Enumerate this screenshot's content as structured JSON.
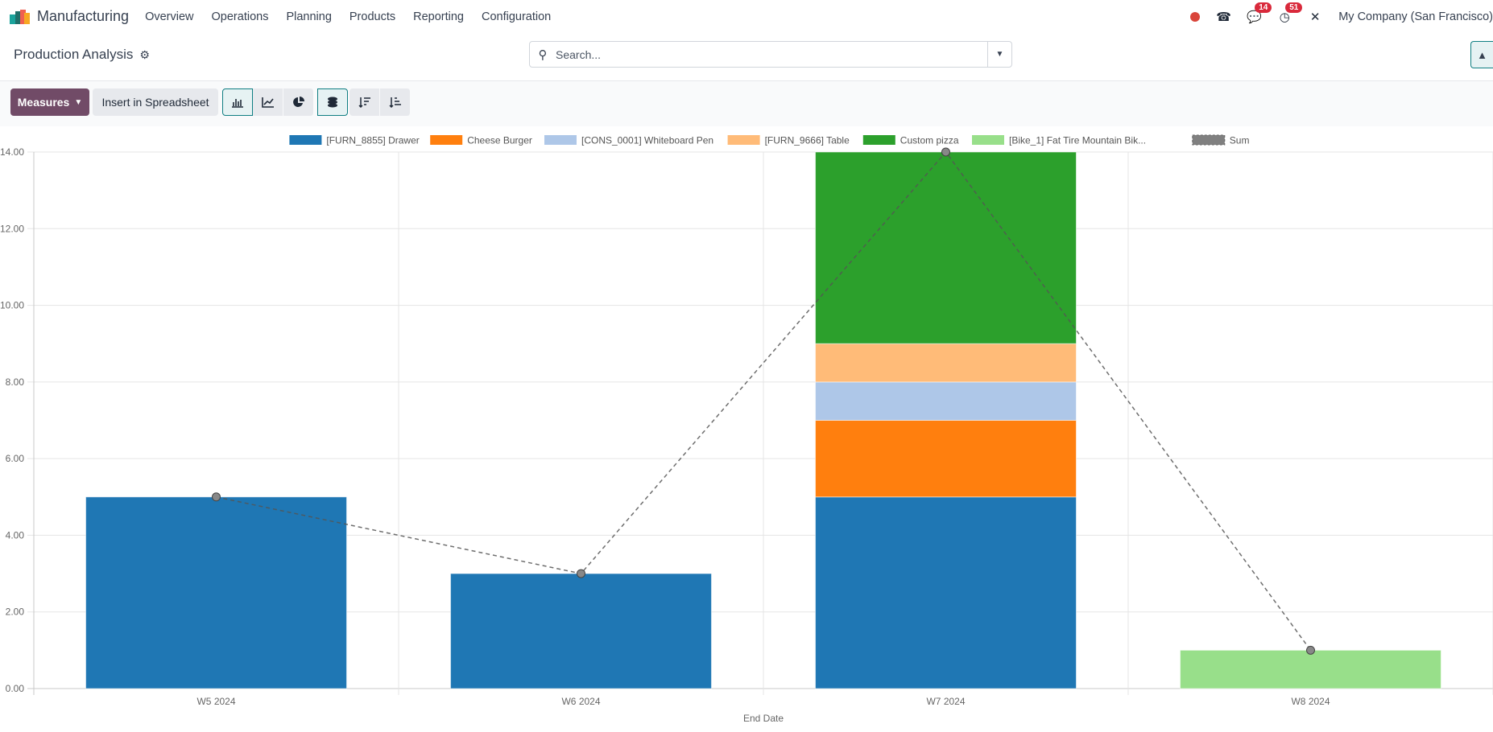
{
  "navbar": {
    "app_name": "Manufacturing",
    "menu": [
      "Overview",
      "Operations",
      "Planning",
      "Products",
      "Reporting",
      "Configuration"
    ],
    "messages_count": "14",
    "activities_count": "51",
    "company": "My Company (San Francisco)"
  },
  "control_panel": {
    "title": "Production Analysis",
    "search_placeholder": "Search..."
  },
  "toolbar": {
    "measures_label": "Measures",
    "spreadsheet_label": "Insert in Spreadsheet"
  },
  "chart_data": {
    "type": "bar",
    "stacked": true,
    "xlabel": "End Date",
    "ylabel": "",
    "ylim": [
      0,
      14
    ],
    "yticks": [
      "0.00",
      "2.00",
      "4.00",
      "6.00",
      "8.00",
      "10.00",
      "12.00",
      "14.00"
    ],
    "grid": true,
    "legend_position": "top",
    "categories": [
      "W5 2024",
      "W6 2024",
      "W7 2024",
      "W8 2024"
    ],
    "series": [
      {
        "name": "[FURN_8855] Drawer",
        "color": "#1f77b4",
        "values": [
          5,
          3,
          5,
          0
        ]
      },
      {
        "name": "Cheese Burger",
        "color": "#ff7f0e",
        "values": [
          0,
          0,
          2,
          0
        ]
      },
      {
        "name": "[CONS_0001] Whiteboard Pen",
        "color": "#aec7e8",
        "values": [
          0,
          0,
          1,
          0
        ]
      },
      {
        "name": "[FURN_9666] Table",
        "color": "#ffbb78",
        "values": [
          0,
          0,
          1,
          0
        ]
      },
      {
        "name": "Custom pizza",
        "color": "#2ca02c",
        "values": [
          0,
          0,
          5,
          0
        ]
      },
      {
        "name": "[Bike_1] Fat Tire Mountain Bik...",
        "color": "#98df8a",
        "values": [
          0,
          0,
          0,
          1
        ]
      }
    ],
    "sum_line": {
      "name": "Sum",
      "color": "#808080",
      "values": [
        5,
        3,
        14,
        1
      ]
    }
  }
}
